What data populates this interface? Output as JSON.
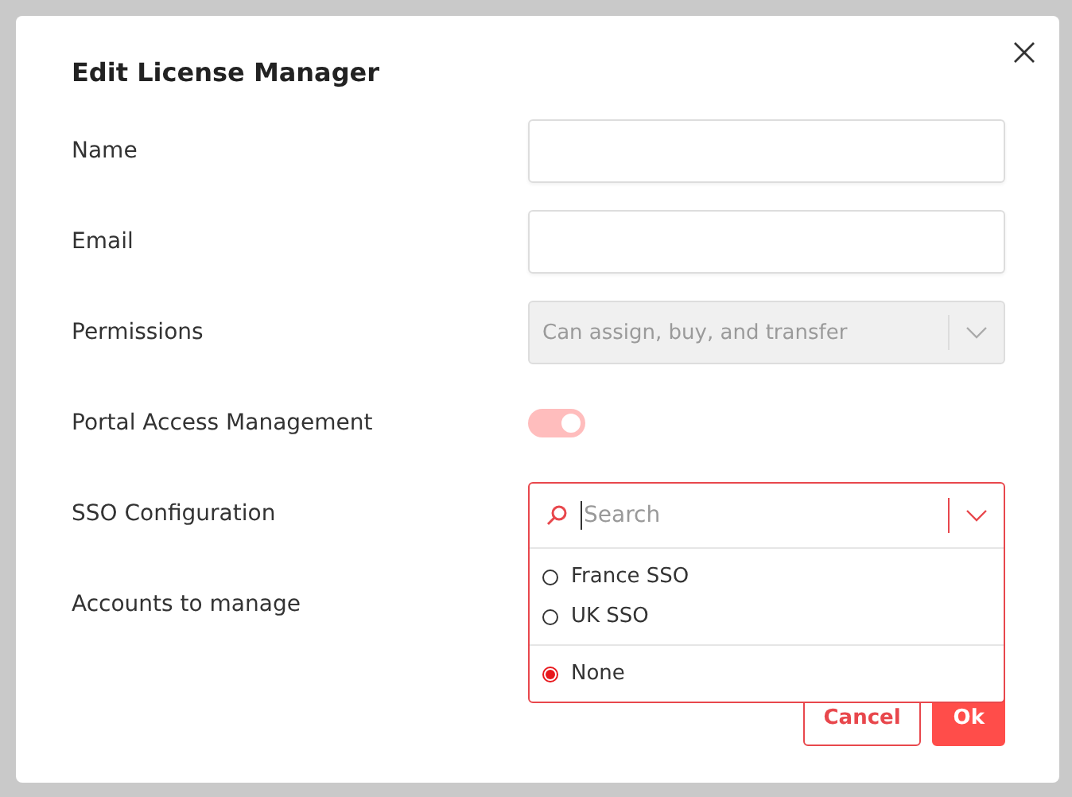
{
  "dialog": {
    "title": "Edit License Manager"
  },
  "fields": [
    {
      "kind": "text",
      "label": "Name"
    },
    {
      "kind": "text",
      "label": "Email"
    },
    {
      "kind": "select",
      "label": "Permissions",
      "value": "Can assign, buy, and transfer",
      "disabled": true
    },
    {
      "kind": "toggle",
      "label": "Portal Access Management",
      "on": true
    },
    {
      "kind": "dropdown",
      "label": "SSO Configuration",
      "placeholder": "Search",
      "expanded": true,
      "groups": [
        {
          "options": [
            {
              "label": "France SSO",
              "selected": false
            },
            {
              "label": "UK SSO",
              "selected": false
            }
          ]
        },
        {
          "options": [
            {
              "label": "None",
              "selected": true
            }
          ]
        }
      ]
    },
    {
      "kind": "hidden",
      "label": "Accounts to manage"
    }
  ],
  "buttons": [
    {
      "kind": "secondary",
      "label": "Cancel"
    },
    {
      "kind": "primary",
      "label": "Ok"
    }
  ]
}
